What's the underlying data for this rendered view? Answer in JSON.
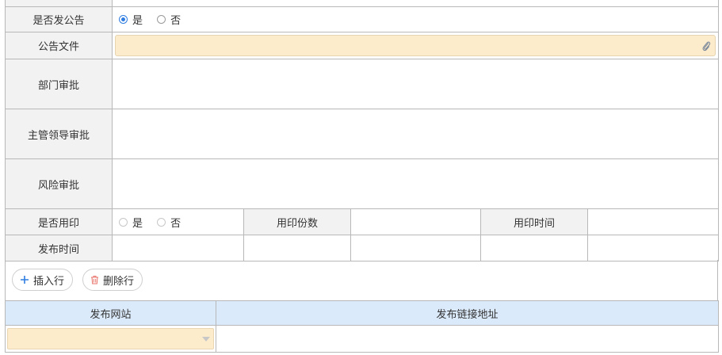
{
  "form": {
    "publish_notice": {
      "label": "是否发公告",
      "options": [
        "是",
        "否"
      ],
      "selected": "是"
    },
    "notice_file": {
      "label": "公告文件",
      "icon": "paperclip-icon"
    },
    "dept_approval": {
      "label": "部门审批"
    },
    "leader_approval": {
      "label": "主管领导审批"
    },
    "risk_approval": {
      "label": "风险审批"
    },
    "use_seal": {
      "label": "是否用印",
      "options": [
        "是",
        "否"
      ]
    },
    "seal_copies": {
      "label": "用印份数"
    },
    "seal_time": {
      "label": "用印时间"
    },
    "publish_time": {
      "label": "发布时间"
    }
  },
  "toolbar": {
    "insert_label": "插入行",
    "delete_label": "删除行",
    "accent": "#2f7de1",
    "delete_icon_color": "#e8736a"
  },
  "sub_table": {
    "headers": [
      "发布网站",
      "发布链接地址"
    ]
  },
  "colors": {
    "label_bg": "#f2f2f2",
    "input_highlight": "#fdeccb",
    "header_bg": "#dbeafa"
  }
}
